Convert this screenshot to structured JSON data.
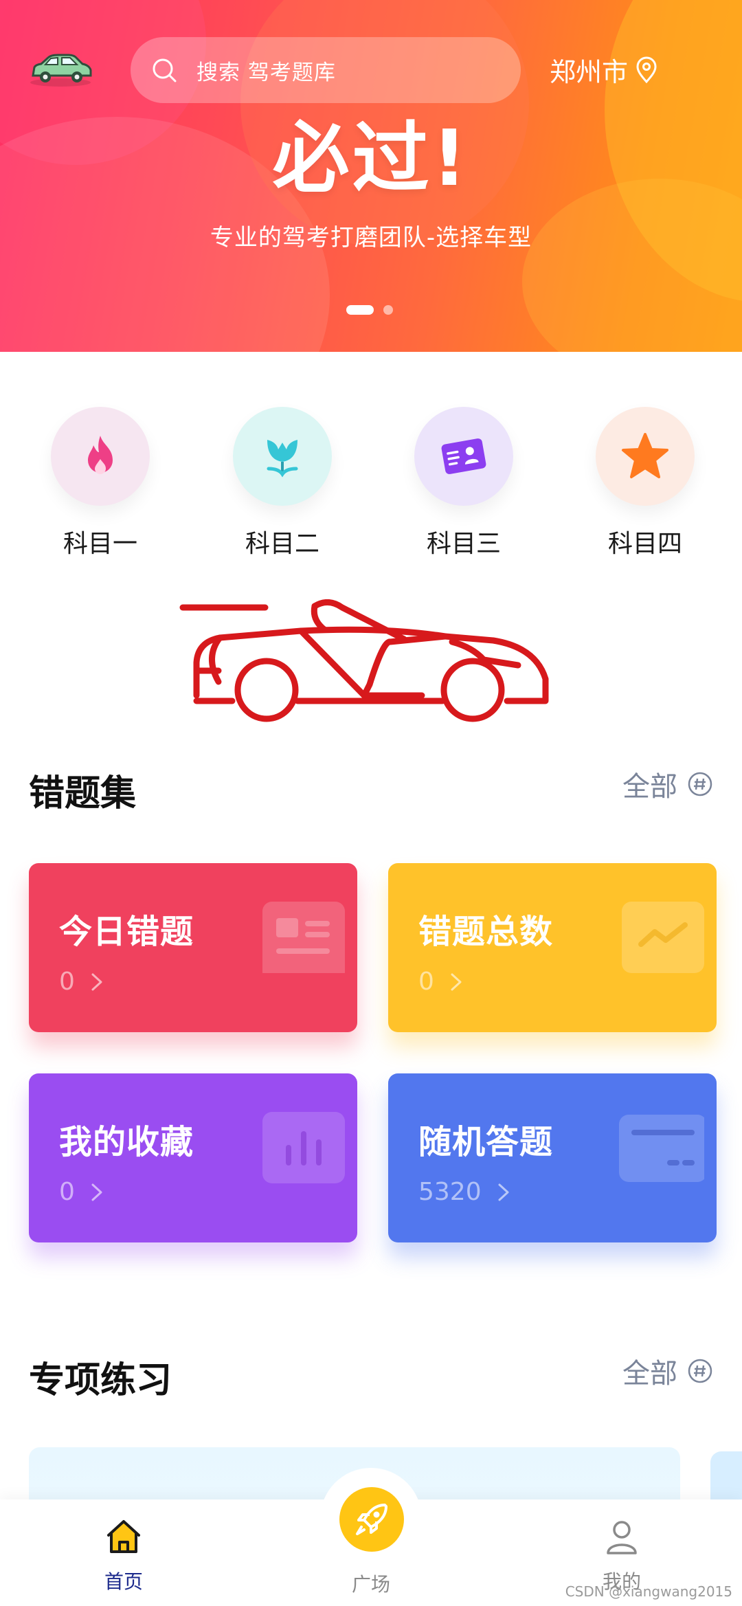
{
  "header": {
    "search_placeholder": "搜索 驾考题库",
    "city": "郑州市"
  },
  "banner": {
    "title": "必过!",
    "subtitle": "专业的驾考打磨团队-选择车型",
    "slides": 2,
    "active_slide": 1
  },
  "subjects": [
    {
      "label": "科目一",
      "icon": "flame-icon",
      "bg": "#f6e6f1",
      "color": "#ee3f86"
    },
    {
      "label": "科目二",
      "icon": "tulip-icon",
      "bg": "#dcf6f4",
      "color": "#35c6d6"
    },
    {
      "label": "科目三",
      "icon": "id-card-icon",
      "bg": "#ece4fb",
      "color": "#8c3ef0"
    },
    {
      "label": "科目四",
      "icon": "star-icon",
      "bg": "#fdebe3",
      "color": "#ff7a1f"
    }
  ],
  "wrong_set": {
    "title": "错题集",
    "more": "全部",
    "cards": [
      {
        "title": "今日错题",
        "count": "0",
        "icon": "news-icon"
      },
      {
        "title": "错题总数",
        "count": "0",
        "icon": "trend-icon"
      },
      {
        "title": "我的收藏",
        "count": "0",
        "icon": "bar-chart-icon"
      },
      {
        "title": "随机答题",
        "count": "5320",
        "icon": "card-icon"
      }
    ]
  },
  "special_practice": {
    "title": "专项练习",
    "more": "全部"
  },
  "nav": {
    "home": "首页",
    "square": "广场",
    "mine": "我的",
    "active": "home",
    "active_color": "#1c2a8c",
    "accent": "#ffc514"
  },
  "watermark": "CSDN @xiangwang2015"
}
